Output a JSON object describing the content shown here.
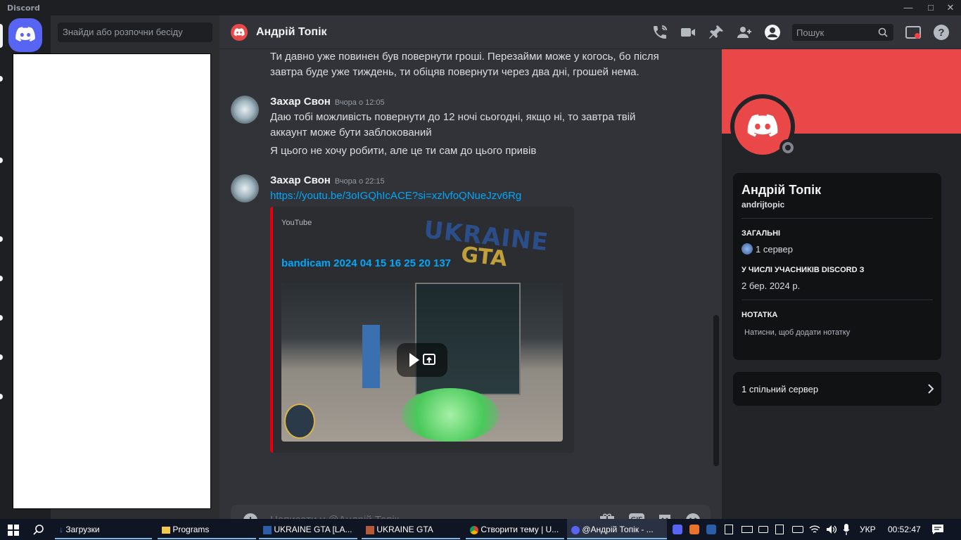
{
  "window": {
    "app_name": "Discord"
  },
  "dm_sidebar": {
    "search_placeholder": "Знайди або розпочни бесіду"
  },
  "header": {
    "user_name": "Андрій Топік",
    "search_placeholder": "Пошук"
  },
  "messages": {
    "prev_text": "Ти давно уже повинен був повернути гроші. Перезайми може у когось, бо після завтра буде уже тиждень, ти обіцяв повернути через два дні, грошей нема.",
    "group1": {
      "author": "Захар Свон",
      "timestamp": "Вчора о 12:05",
      "lines": [
        "Даю тобі можливість повернути до 12 ночі сьогодні, якщо ні, то завтра твій аккаунт може бути заблокований",
        "Я цього не хочу робити, але це ти сам до цього привів"
      ]
    },
    "group2": {
      "author": "Захар Свон",
      "timestamp": "Вчора о 22:15",
      "link": "https://youtu.be/3oIGQhIcACE?si=xzlvfoQNueJzv6Rg",
      "embed": {
        "provider": "YouTube",
        "title": "bandicam 2024 04 15 16 25 20 137",
        "overlay_logo_line1": "UKRAINE",
        "overlay_logo_line2": "GTA"
      }
    }
  },
  "composer": {
    "placeholder": "Написати у @Андрій Топік",
    "gif_label": "GIF"
  },
  "profile": {
    "display_name": "Андрій Топік",
    "username": "andrijtopic",
    "general_heading": "ЗАГАЛЬНІ",
    "servers_count": "1 сервер",
    "member_since_heading": "У ЧИСЛІ УЧАСНИКІВ DISCORD З",
    "member_since": "2 бер. 2024 р.",
    "note_heading": "НОТАТКА",
    "note_placeholder": "Натисни, щоб додати нотатку",
    "mutual_servers": "1 спільний сервер",
    "banner_color": "#ea4848"
  },
  "taskbar": {
    "items": [
      "Загрузки",
      "Programs",
      "UKRAINE GTA [LA...",
      "UKRAINE GTA",
      "Створити тему | U...",
      "@Андрій Топік - ..."
    ],
    "language": "УКР",
    "time": "00:52:47"
  }
}
